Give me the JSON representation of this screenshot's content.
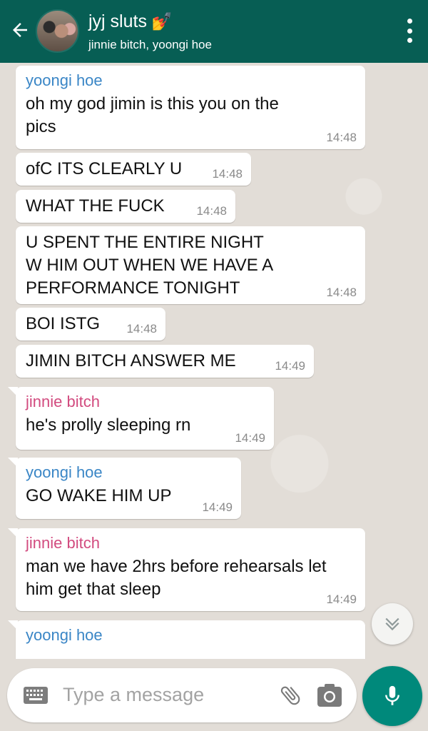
{
  "header": {
    "title": "jyj sluts",
    "title_emoji": "💅",
    "subtitle": "jinnie bitch, yoongi hoe"
  },
  "messages": [
    {
      "sender": "yoongi hoe",
      "text_lines": [
        "oh my god jimin is this you on the",
        "pics"
      ],
      "time": "14:48"
    },
    {
      "text_lines": [
        "ofC ITS CLEARLY U"
      ],
      "time": "14:48"
    },
    {
      "text_lines": [
        "WHAT THE FUCK"
      ],
      "time": "14:48"
    },
    {
      "text_lines": [
        "U SPENT THE ENTIRE NIGHT",
        "W HIM OUT WHEN WE HAVE A",
        "PERFORMANCE TONIGHT"
      ],
      "time": "14:48"
    },
    {
      "text_lines": [
        "BOI ISTG"
      ],
      "time": "14:48"
    },
    {
      "text_lines": [
        "JIMIN BITCH ANSWER ME"
      ],
      "time": "14:49"
    },
    {
      "sender": "jinnie bitch",
      "text_lines": [
        "he's prolly sleeping rn"
      ],
      "time": "14:49"
    },
    {
      "sender": "yoongi hoe",
      "text_lines": [
        "GO WAKE HIM UP"
      ],
      "time": "14:49"
    },
    {
      "sender": "jinnie bitch",
      "text_lines": [
        "man we have 2hrs before rehearsals let",
        "him get that sleep"
      ],
      "time": "14:49"
    },
    {
      "sender": "yoongi hoe",
      "text_lines": [],
      "time": ""
    }
  ],
  "input": {
    "placeholder": "Type a message"
  },
  "icons": {
    "back": "arrow-left-icon",
    "menu": "more-vertical-icon",
    "scroll_down": "chevron-double-down-icon",
    "keyboard": "keyboard-icon",
    "attach": "paperclip-icon",
    "camera": "camera-icon",
    "mic": "microphone-icon"
  },
  "colors": {
    "header_bg": "#075e54",
    "accent": "#00897b",
    "yoongi_name": "#3a86c6",
    "jinnie_name": "#d24b7f"
  }
}
